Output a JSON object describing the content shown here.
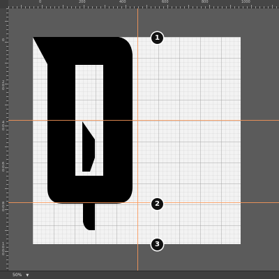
{
  "ruler": {
    "top_labels": [
      "0",
      "200",
      "400",
      "600",
      "800",
      "1000"
    ],
    "left_labels": [
      "0",
      "200",
      "400",
      "600",
      "800",
      "1000"
    ]
  },
  "markers": [
    "1",
    "2",
    "3"
  ],
  "statusbar": {
    "zoom": "50%"
  },
  "colors": {
    "workspace": "#5b5b5b",
    "artboard": "#f3f3f3",
    "guide": "#ff9a5a",
    "glyph": "#000000"
  }
}
